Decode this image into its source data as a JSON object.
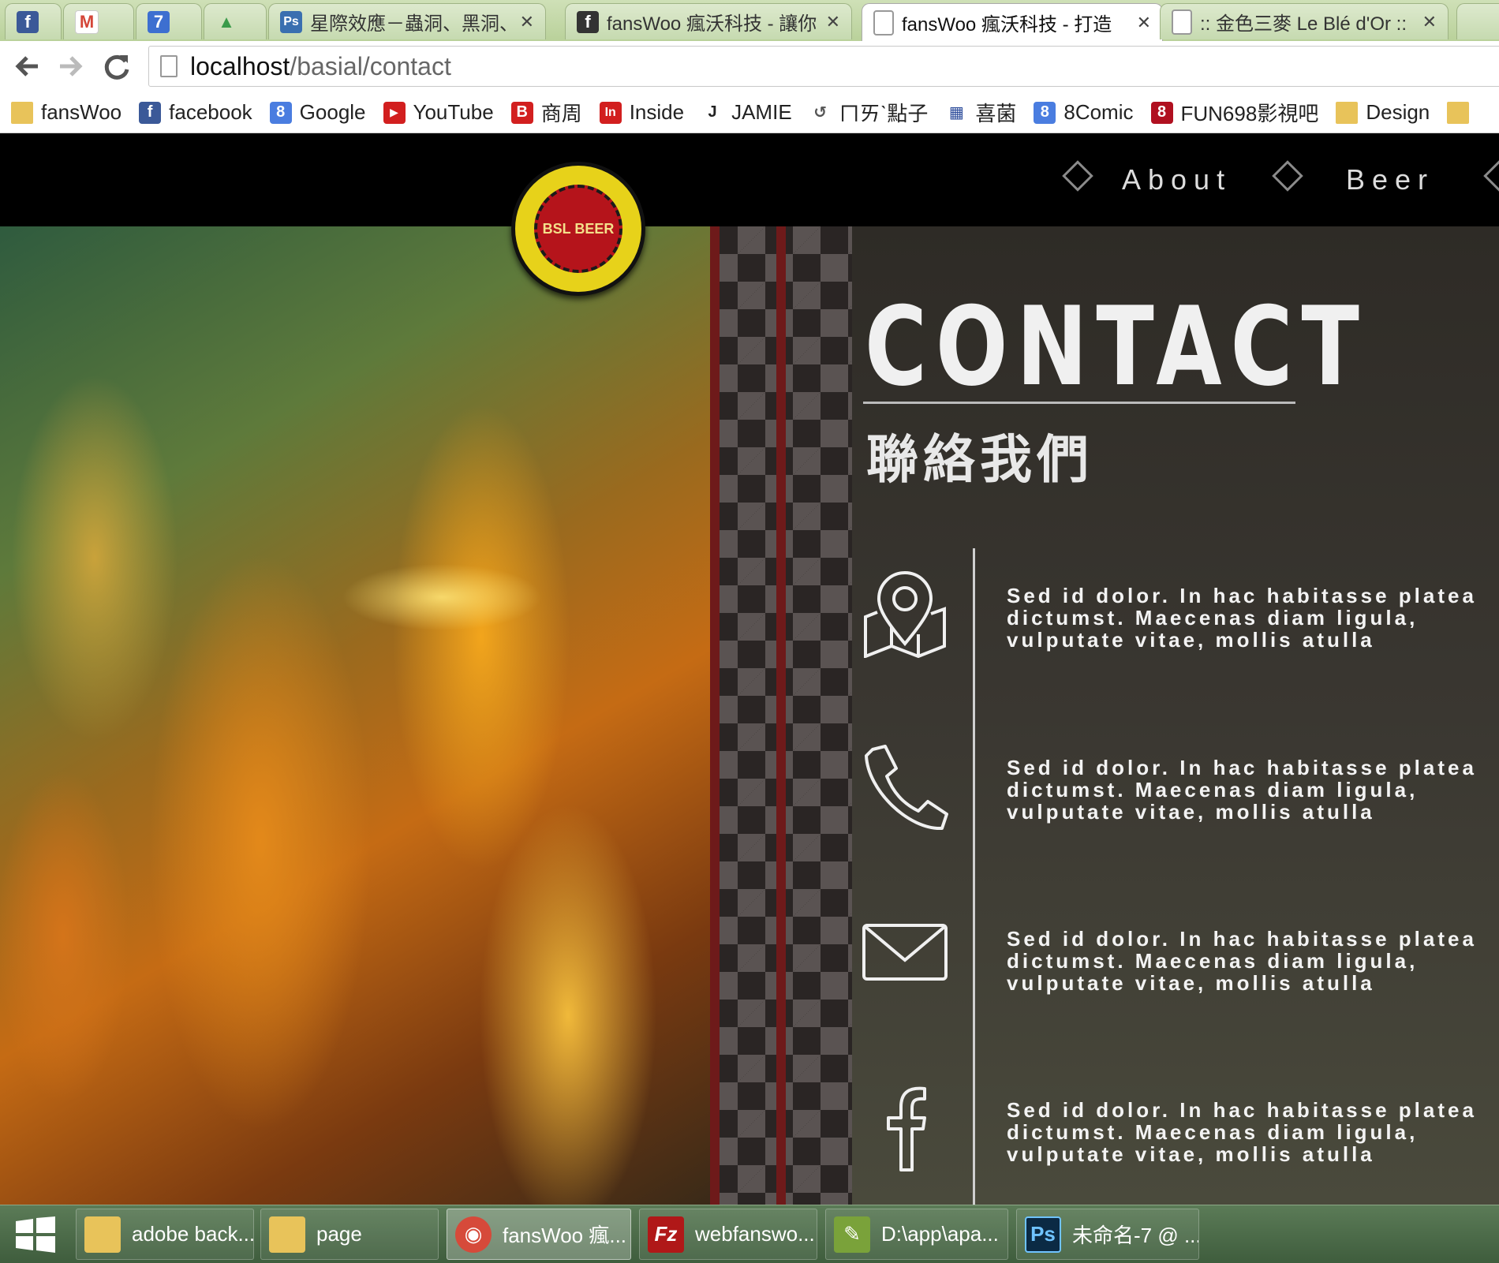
{
  "browser": {
    "tabs": [
      {
        "title": "",
        "favicon": "facebook-icon",
        "favicon_text": "f",
        "color": "#3b5998"
      },
      {
        "title": "",
        "favicon": "gmail-icon",
        "favicon_text": "M",
        "color": "#d44638"
      },
      {
        "title": "",
        "favicon": "calendar-icon",
        "favicon_text": "7",
        "color": "#3d6fd0"
      },
      {
        "title": "",
        "favicon": "drive-icon",
        "favicon_text": "▲",
        "color": "#3a9a4a"
      },
      {
        "title": "星際效應－蟲洞、黑洞、",
        "favicon": "photoshop-icon",
        "favicon_text": "Ps",
        "color": "#3a6fb0"
      },
      {
        "title": "fansWoo 瘋沃科技 - 讓你",
        "favicon": "facebook-icon",
        "favicon_text": "f",
        "color": "#333333"
      },
      {
        "title": "fansWoo 瘋沃科技 - 打造",
        "favicon": "page-icon",
        "favicon_text": "",
        "color": "#ffffff"
      },
      {
        "title": ":: 金色三麥 Le Blé d'Or ::",
        "favicon": "page-icon",
        "favicon_text": "",
        "color": "#ffffff"
      }
    ],
    "address": {
      "host": "localhost",
      "path": "/basial/contact"
    },
    "bookmarks": [
      {
        "label": "fansWoo",
        "icon": "folder-icon",
        "icon_text": "",
        "color": "#e8c35a"
      },
      {
        "label": "facebook",
        "icon": "facebook-icon",
        "icon_text": "f",
        "color": "#3b5998"
      },
      {
        "label": "Google",
        "icon": "google-icon",
        "icon_text": "8",
        "color": "#4a7de0"
      },
      {
        "label": "YouTube",
        "icon": "youtube-icon",
        "icon_text": "▶",
        "color": "#d21f1f"
      },
      {
        "label": "商周",
        "icon": "bw-icon",
        "icon_text": "B",
        "color": "#d21f1f"
      },
      {
        "label": "Inside",
        "icon": "inside-icon",
        "icon_text": "In",
        "color": "#d21f1f"
      },
      {
        "label": "JAMIE",
        "icon": "jamie-icon",
        "icon_text": "J",
        "color": "#222222"
      },
      {
        "label": "ㄇㄞˋ點子",
        "icon": "refresh-icon",
        "icon_text": "↺",
        "color": "#555555"
      },
      {
        "label": "喜菌",
        "icon": "grid-icon",
        "icon_text": "▦",
        "color": "#2a4a9a"
      },
      {
        "label": "8Comic",
        "icon": "google-icon",
        "icon_text": "8",
        "color": "#4a7de0"
      },
      {
        "label": "FUN698影視吧",
        "icon": "fun698-icon",
        "icon_text": "8",
        "color": "#b01020"
      },
      {
        "label": "Design",
        "icon": "folder-icon",
        "icon_text": "",
        "color": "#e8c35a"
      },
      {
        "label": "",
        "icon": "folder-icon",
        "icon_text": "",
        "color": "#e8c35a"
      }
    ]
  },
  "site": {
    "nav": [
      {
        "label": "About"
      },
      {
        "label": "Beer"
      }
    ],
    "logo_text": "BSL BEER",
    "title": "CONTACT",
    "subtitle": "聯絡我們",
    "contact_items": [
      {
        "icon": "map-pin-icon",
        "text": "Sed id dolor. In hac habitasse platea dictumst. Maecenas diam ligula, vulputate vitae, mollis atulla"
      },
      {
        "icon": "phone-icon",
        "text": "Sed id dolor. In hac habitasse platea dictumst. Maecenas diam ligula, vulputate vitae, mollis atulla"
      },
      {
        "icon": "mail-icon",
        "text": "Sed id dolor. In hac habitasse platea dictumst. Maecenas diam ligula, vulputate vitae, mollis atulla"
      },
      {
        "icon": "facebook-icon",
        "text": "Sed id dolor. In hac habitasse platea dictumst. Maecenas diam ligula, vulputate vitae, mollis atulla"
      }
    ]
  },
  "taskbar": {
    "items": [
      {
        "label": "adobe back...",
        "icon": "folder-icon",
        "icon_text": "",
        "color": "#e8c35a"
      },
      {
        "label": "page",
        "icon": "folder-icon",
        "icon_text": "",
        "color": "#e8c35a"
      },
      {
        "label": "fansWoo 瘋...",
        "icon": "chrome-icon",
        "icon_text": "◉",
        "color": "#d64a3a"
      },
      {
        "label": "webfanswo...",
        "icon": "filezilla-icon",
        "icon_text": "Fz",
        "color": "#b01818"
      },
      {
        "label": "D:\\app\\apa...",
        "icon": "notepad-icon",
        "icon_text": "✎",
        "color": "#7aa23a"
      },
      {
        "label": "未命名-7 @ ...",
        "icon": "photoshop-icon",
        "icon_text": "Ps",
        "color": "#0b2a44"
      }
    ]
  }
}
